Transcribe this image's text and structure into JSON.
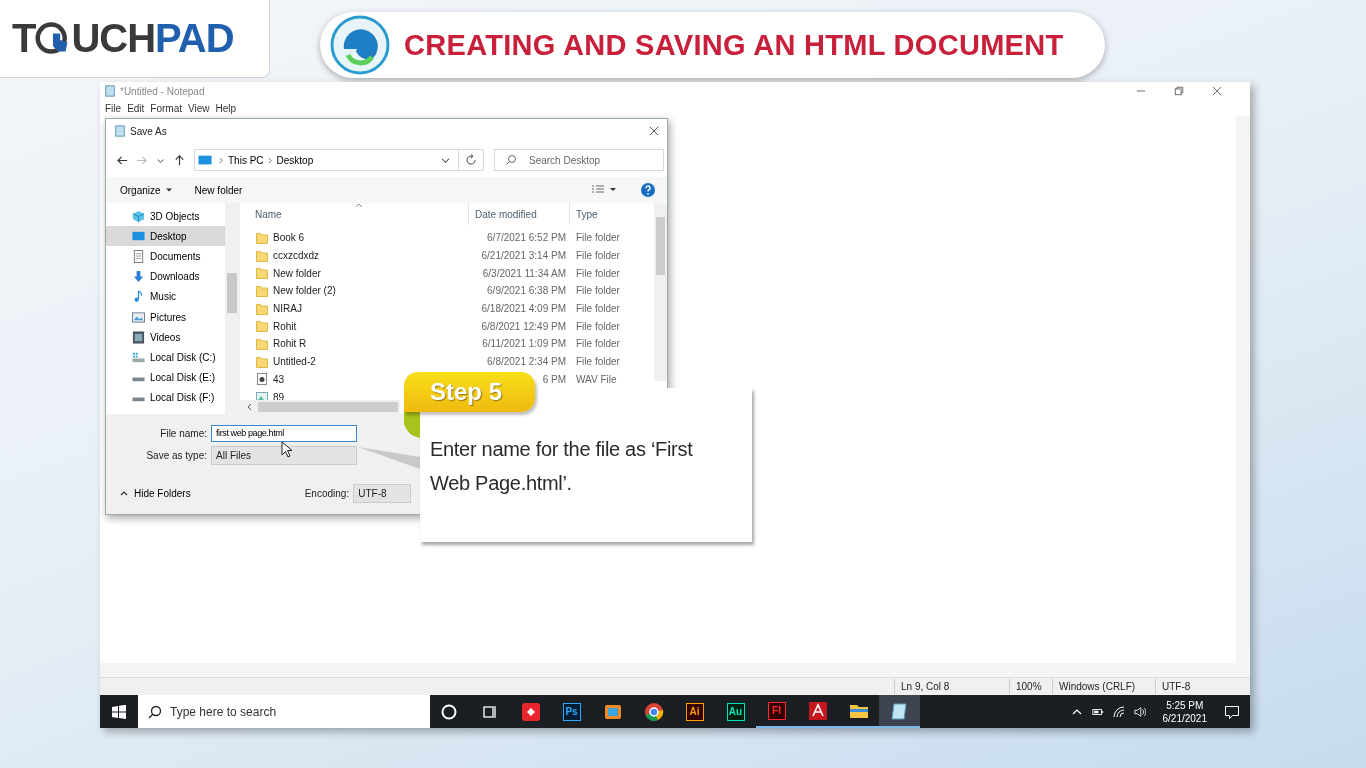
{
  "logo": {
    "text_1": "T",
    "text_2": "UCH",
    "accent": "PAD"
  },
  "banner": {
    "title": "CREATING AND SAVING AN HTML DOCUMENT"
  },
  "notepad": {
    "title": "*Untitled - Notepad",
    "menu": [
      "File",
      "Edit",
      "Format",
      "View",
      "Help"
    ],
    "status": [
      "Ln 9, Col 8",
      "100%",
      "Windows (CRLF)",
      "UTF-8"
    ]
  },
  "dialog": {
    "title": "Save As",
    "nav_buttons": [
      {
        "kind": "back",
        "disabled": false
      },
      {
        "kind": "forward",
        "disabled": true
      },
      {
        "kind": "recent",
        "disabled": false
      },
      {
        "kind": "up",
        "disabled": false
      }
    ],
    "breadcrumb": [
      "This PC",
      "Desktop"
    ],
    "search": {
      "placeholder": "Search Desktop"
    },
    "toolbar": [
      "Organize",
      "New folder"
    ],
    "nav_pane": [
      {
        "label": "3D Objects",
        "kind": "objects",
        "selected": false
      },
      {
        "label": "Desktop",
        "kind": "desktop",
        "selected": true
      },
      {
        "label": "Documents",
        "kind": "documents",
        "selected": false
      },
      {
        "label": "Downloads",
        "kind": "downloads",
        "selected": false
      },
      {
        "label": "Music",
        "kind": "music",
        "selected": false
      },
      {
        "label": "Pictures",
        "kind": "pictures",
        "selected": false
      },
      {
        "label": "Videos",
        "kind": "videos",
        "selected": false
      },
      {
        "label": "Local Disk (C:)",
        "kind": "system",
        "selected": false
      },
      {
        "label": "Local Disk (E:)",
        "kind": "disk",
        "selected": false
      },
      {
        "label": "Local Disk (F:)",
        "kind": "disk",
        "selected": false
      }
    ],
    "columns": [
      "Name",
      "Date modified",
      "Type"
    ],
    "files": [
      {
        "name": "Book 6",
        "date": "6/7/2021 6:52 PM",
        "type": "File folder",
        "kind": "folder"
      },
      {
        "name": "ccxzcdxdz",
        "date": "6/21/2021 3:14 PM",
        "type": "File folder",
        "kind": "folder"
      },
      {
        "name": "New folder",
        "date": "6/3/2021 11:34 AM",
        "type": "File folder",
        "kind": "folder"
      },
      {
        "name": "New folder (2)",
        "date": "6/9/2021 6:38 PM",
        "type": "File folder",
        "kind": "folder"
      },
      {
        "name": "NIRAJ",
        "date": "6/18/2021 4:09 PM",
        "type": "File folder",
        "kind": "folder"
      },
      {
        "name": "Rohit",
        "date": "6/8/2021 12:49 PM",
        "type": "File folder",
        "kind": "folder"
      },
      {
        "name": "Rohit R",
        "date": "6/11/2021 1:09 PM",
        "type": "File folder",
        "kind": "folder"
      },
      {
        "name": "Untitled-2",
        "date": "6/8/2021 2:34 PM",
        "type": "File folder",
        "kind": "folder"
      },
      {
        "name": "43",
        "date": "6 PM",
        "type": "WAV File",
        "kind": "audio"
      },
      {
        "name": "89",
        "kind": "image"
      }
    ],
    "file_name": {
      "label": "File name:",
      "value": "first web page.html"
    },
    "save_as_type": {
      "label": "Save as type:",
      "value": "All Files"
    },
    "hide_folders": "Hide Folders",
    "encoding": {
      "label": "Encoding:",
      "value": "UTF-8"
    }
  },
  "callout": {
    "step": "Step 5",
    "text": "Enter name for the file as ‘First Web Page.html’."
  },
  "taskbar": {
    "search": {
      "placeholder": "Type here to search"
    },
    "apps": [
      {
        "kind": "cortana",
        "selected": false,
        "running": false
      },
      {
        "kind": "taskview",
        "selected": false,
        "running": false
      },
      {
        "kind": "redapp",
        "selected": false,
        "running": false
      },
      {
        "kind": "ps",
        "label": "Ps",
        "selected": false,
        "running": false
      },
      {
        "kind": "media",
        "selected": false,
        "running": false
      },
      {
        "kind": "chrome",
        "selected": false,
        "running": false
      },
      {
        "kind": "ai",
        "label": "Ai",
        "selected": false,
        "running": false
      },
      {
        "kind": "au",
        "label": "Au",
        "selected": false,
        "running": false
      },
      {
        "kind": "fl",
        "label": "Fl",
        "selected": false,
        "running": true
      },
      {
        "kind": "acrobat",
        "selected": false,
        "running": true
      },
      {
        "kind": "explorer",
        "selected": false,
        "running": true
      },
      {
        "kind": "notepad",
        "selected": true,
        "running": true
      }
    ],
    "time": "5:25 PM",
    "date": "6/21/2021"
  }
}
